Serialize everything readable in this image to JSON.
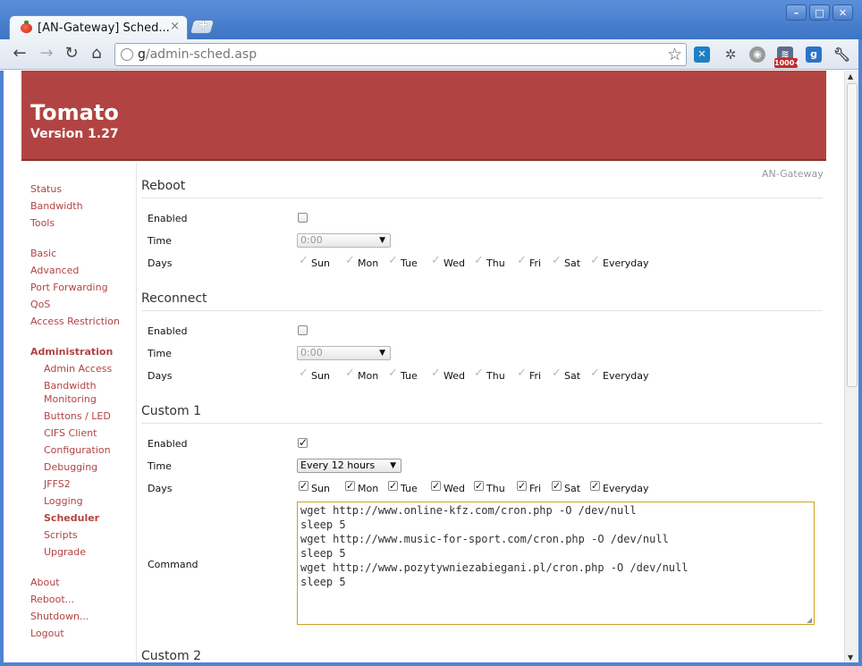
{
  "browser": {
    "tab_title": "[AN-Gateway] Sched...",
    "tab_close": "×",
    "new_tab": "+",
    "url_host": "g",
    "url_rest": "/admin-sched.asp",
    "ext_badge": "1000+",
    "window_buttons": [
      "–",
      "□",
      "✕"
    ]
  },
  "banner": {
    "title": "Tomato",
    "version": "Version 1.27"
  },
  "hostname": "AN-Gateway",
  "nav": {
    "group1": [
      "Status",
      "Bandwidth",
      "Tools"
    ],
    "group2": [
      "Basic",
      "Advanced",
      "Port Forwarding",
      "QoS",
      "Access Restriction"
    ],
    "admin_header": "Administration",
    "admin_items": [
      "Admin Access",
      "Bandwidth",
      "Monitoring",
      "Buttons / LED",
      "CIFS Client",
      "Configuration",
      "Debugging",
      "JFFS2",
      "Logging",
      "Scheduler",
      "Scripts",
      "Upgrade"
    ],
    "group4": [
      "About",
      "Reboot...",
      "Shutdown...",
      "Logout"
    ]
  },
  "labels": {
    "enabled": "Enabled",
    "time": "Time",
    "days": "Days",
    "command": "Command"
  },
  "days": [
    "Sun",
    "Mon",
    "Tue",
    "Wed",
    "Thu",
    "Fri",
    "Sat",
    "Everyday"
  ],
  "sections": {
    "reboot": {
      "title": "Reboot",
      "enabled": false,
      "time": "0:00"
    },
    "reconnect": {
      "title": "Reconnect",
      "enabled": false,
      "time": "0:00"
    },
    "custom1": {
      "title": "Custom 1",
      "enabled": true,
      "time": "Every 12 hours",
      "command": "wget http://www.online-kfz.com/cron.php -O /dev/null\nsleep 5\nwget http://www.music-for-sport.com/cron.php -O /dev/null\nsleep 5\nwget http://www.pozytywniezabiegani.pl/cron.php -O /dev/null\nsleep 5"
    },
    "custom2": {
      "title": "Custom 2"
    }
  },
  "colors": {
    "brand": "#b14442",
    "link": "#b14442",
    "chrome": "#4d84d0"
  }
}
